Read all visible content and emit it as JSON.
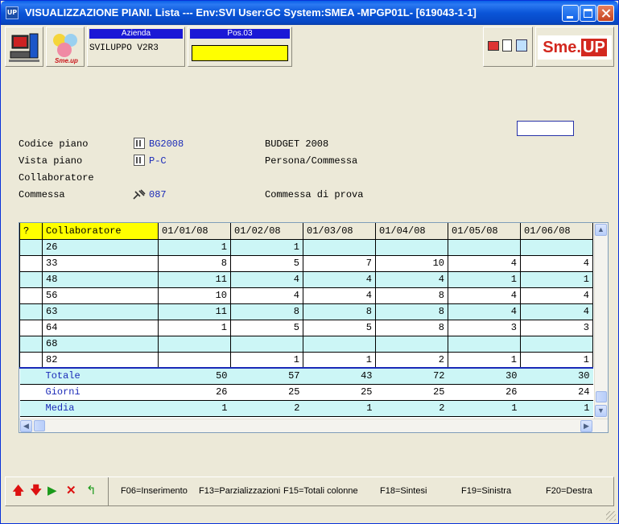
{
  "window": {
    "app_icon": "UP",
    "title": "VISUALIZZAZIONE PIANI.  Lista --- Env:SVI User:GC System:SMEA -MPGP01L- [619043-1-1]"
  },
  "header": {
    "azienda_label": "Azienda",
    "azienda_value": "SVILUPPO V2R3",
    "pos_label": "Pos.03",
    "logo_small_text": "Sme.up",
    "logo_left": "Sme.",
    "logo_right": "UP"
  },
  "form": {
    "codice_label": "Codice piano",
    "codice_value": "BG2008",
    "codice_desc": "BUDGET 2008",
    "vista_label": "Vista piano",
    "vista_value": "P-C",
    "vista_desc": "Persona/Commessa",
    "collaboratore_label": "Collaboratore",
    "commessa_label": "Commessa",
    "commessa_value": "087",
    "commessa_desc": "Commessa di prova"
  },
  "grid": {
    "headers": [
      "?",
      "Collaboratore",
      "01/01/08",
      "01/02/08",
      "01/03/08",
      "01/04/08",
      "01/05/08",
      "01/06/08"
    ],
    "rows": [
      {
        "id": "26",
        "vals": [
          "1",
          "1",
          "",
          "",
          "",
          ""
        ]
      },
      {
        "id": "33",
        "vals": [
          "8",
          "5",
          "7",
          "10",
          "4",
          "4"
        ]
      },
      {
        "id": "48",
        "vals": [
          "11",
          "4",
          "4",
          "4",
          "1",
          "1"
        ]
      },
      {
        "id": "56",
        "vals": [
          "10",
          "4",
          "4",
          "8",
          "4",
          "4"
        ]
      },
      {
        "id": "63",
        "vals": [
          "11",
          "8",
          "8",
          "8",
          "4",
          "4"
        ]
      },
      {
        "id": "64",
        "vals": [
          "1",
          "5",
          "5",
          "8",
          "3",
          "3"
        ]
      },
      {
        "id": "68",
        "vals": [
          "",
          "",
          "",
          "",
          "",
          ""
        ]
      },
      {
        "id": "82",
        "vals": [
          "",
          "1",
          "1",
          "2",
          "1",
          "1"
        ]
      }
    ],
    "totals": [
      {
        "label": "Totale",
        "vals": [
          "50",
          "57",
          "43",
          "72",
          "30",
          "30"
        ]
      },
      {
        "label": "Giorni",
        "vals": [
          "26",
          "25",
          "25",
          "25",
          "26",
          "24"
        ]
      },
      {
        "label": "Media",
        "vals": [
          "1",
          "2",
          "1",
          "2",
          "1",
          "1"
        ]
      }
    ]
  },
  "footer": {
    "keys": [
      "F06=Inserimento",
      "F13=Parzializzazioni",
      "F15=Totali colonne",
      "F18=Sintesi",
      "F19=Sinistra",
      "F20=Destra"
    ]
  },
  "colors": {
    "title_bar": "#0A55D8",
    "row_alt": "#ccf6f6",
    "header_yellow": "#FFFF00",
    "value_blue": "#1a2ab8",
    "label_blue": "#1a18d6"
  }
}
